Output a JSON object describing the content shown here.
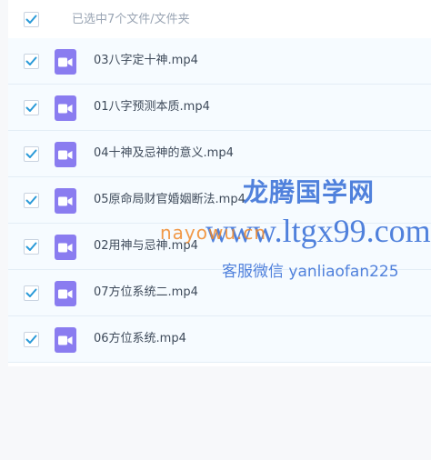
{
  "header": {
    "selection_text": "已选中7个文件/文件夹"
  },
  "files": [
    {
      "name": "03八字定十神.mp4",
      "checked": true,
      "icon": "video-file-icon"
    },
    {
      "name": "01八字预测本质.mp4",
      "checked": true,
      "icon": "video-file-icon"
    },
    {
      "name": "04十神及忌神的意义.mp4",
      "checked": true,
      "icon": "video-file-icon"
    },
    {
      "name": "05原命局财官婚姻断法.mp4",
      "checked": true,
      "icon": "video-file-icon"
    },
    {
      "name": "02用神与忌神.mp4",
      "checked": true,
      "icon": "video-file-icon"
    },
    {
      "name": "07方位系统二.mp4",
      "checked": true,
      "icon": "video-file-icon"
    },
    {
      "name": "06方位系统.mp4",
      "checked": true,
      "icon": "video-file-icon"
    }
  ],
  "watermark": {
    "title": "龙腾国学网",
    "url": "www.ltgx99.com",
    "nayo": "nayowu.cn",
    "service": "客服微信 yanliaofan225"
  },
  "colors": {
    "checkbox_tick": "#2a9ad8",
    "file_icon_bg": "#8a7cf0",
    "row_bg": "#f6fbff",
    "watermark_blue": "#2b65d4",
    "watermark_orange": "#f08728"
  }
}
